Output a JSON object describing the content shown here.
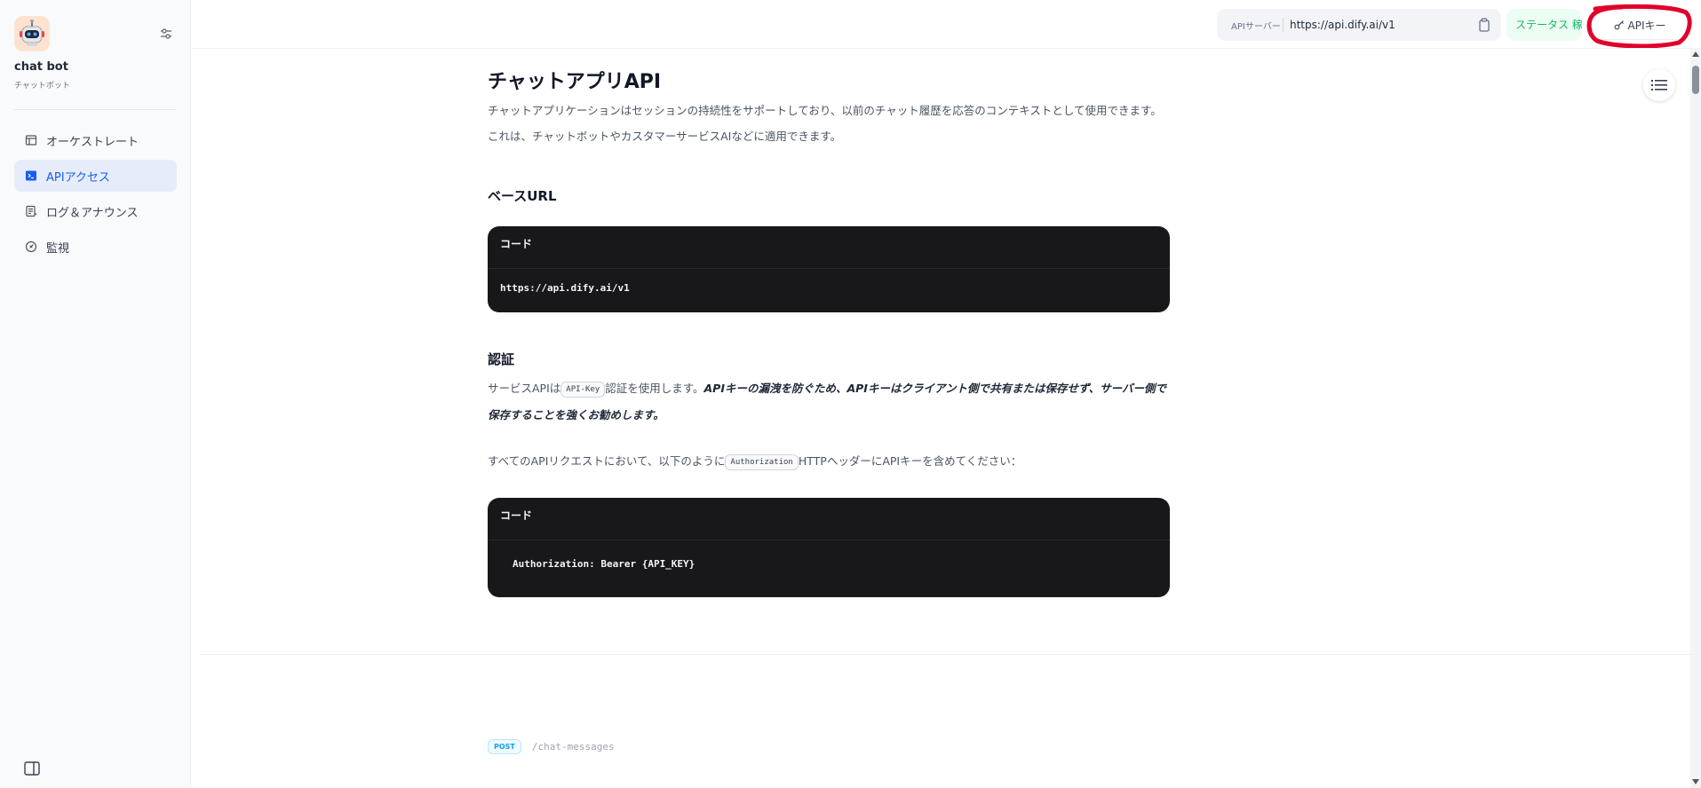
{
  "sidebar": {
    "app_name": "chat bot",
    "app_type": "チャットボット",
    "items": [
      {
        "label": "オーケストレート",
        "icon": "layout-icon"
      },
      {
        "label": "APIアクセス",
        "icon": "terminal-icon",
        "active": true
      },
      {
        "label": "ログ＆アナウンス",
        "icon": "log-icon"
      },
      {
        "label": "監視",
        "icon": "monitor-icon"
      }
    ]
  },
  "topbar": {
    "api_server_label": "APIサーバー",
    "api_server_url": "https://api.dify.ai/v1",
    "status_text": "ステータス 稼働中",
    "api_key_label": "APIキー"
  },
  "content": {
    "title": "チャットアプリAPI",
    "intro": "チャットアプリケーションはセッションの持続性をサポートしており、以前のチャット履歴を応答のコンテキストとして使用できます。これは、チャットボットやカスタマーサービスAIなどに適用できます。",
    "base_url_heading": "ベースURL",
    "code1_header": "コード",
    "code1_body": "https://api.dify.ai/v1",
    "auth_heading": "認証",
    "auth_p1_pre": "サービスAPIは",
    "auth_p1_chip": "API-Key",
    "auth_p1_mid": "認証を使用します。",
    "auth_p1_em": "APIキーの漏洩を防ぐため、APIキーはクライアント側で共有または保存せず、サーバー側で保存することを強くお勧めします。",
    "auth_p2_pre": "すべてのAPIリクエストにおいて、以下のように",
    "auth_p2_chip": "Authorization",
    "auth_p2_post": "HTTPヘッダーにAPIキーを含めてください：",
    "code2_header": "コード",
    "code2_body": "Authorization: Bearer {API_KEY}",
    "endpoint_method": "POST",
    "endpoint_path": "/chat-messages"
  },
  "colors": {
    "accent": "#155eef",
    "status_green": "#12b76a",
    "code_bg": "#18181b",
    "annotation_red": "#e0002a"
  }
}
